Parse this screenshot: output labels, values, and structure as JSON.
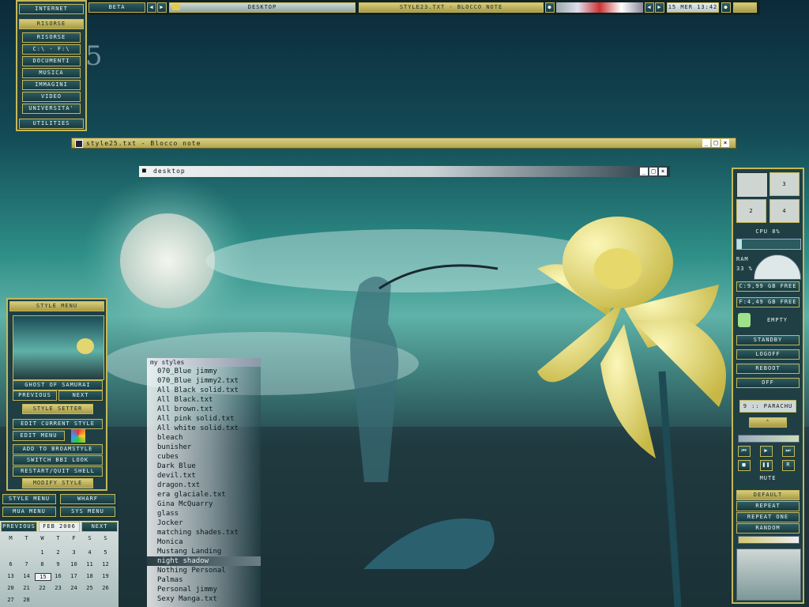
{
  "taskbar": {
    "workspace": "BETA",
    "window_title": "DESKTOP",
    "active_task": "STYLE23.TXT - BLOCCO NOTE",
    "clock": "15 MER 13:42"
  },
  "left_menu": {
    "items": [
      "INTERNET",
      "RISORSE",
      "RISORSE",
      "C:\\ - F:\\",
      "DOCUMENTI",
      "MUSICA",
      "IMMAGINI",
      "VIDEO",
      "UNIVERSITA'",
      "UTILITIES"
    ]
  },
  "windows": {
    "notepad_title": "style25.txt - Blocco note",
    "desktop_title": "desktop"
  },
  "style_menu": {
    "title": "STYLE MENU",
    "preview_caption": "GHOST OF SAMURAI",
    "previous": "PREVIOUS",
    "next": "NEXT",
    "setter": "STYLE SETTER",
    "edit_current": "EDIT CURRENT STYLE",
    "edit_menu": "EDIT MENU",
    "add_bro": "ADD TO BROAMSTYLE",
    "switch": "SWITCH BBI LOOK",
    "restart": "RESTART/QUIT SHELL",
    "modify": "MODIFY STYLE"
  },
  "dock": {
    "style_menu": "STYLE MENU",
    "wharf": "WHARF",
    "mua": "MUA MENU",
    "sys": "SYS MENU"
  },
  "calendar": {
    "previous": "PREVIOUS",
    "month": "FEB 2006",
    "next": "NEXT",
    "weekdays": [
      "M",
      "T",
      "W",
      "T",
      "F",
      "S",
      "S"
    ],
    "rows": [
      [
        "",
        "",
        "1",
        "2",
        "3",
        "4",
        "5"
      ],
      [
        "6",
        "7",
        "8",
        "9",
        "10",
        "11",
        "12"
      ],
      [
        "13",
        "14",
        "15",
        "16",
        "17",
        "18",
        "19"
      ],
      [
        "20",
        "21",
        "22",
        "23",
        "24",
        "25",
        "26"
      ],
      [
        "27",
        "28",
        "",
        "",
        "",
        "",
        ""
      ]
    ],
    "today": "15"
  },
  "styles_menu": {
    "header": "my styles",
    "items": [
      "070_Blue jimmy",
      "070_Blue jimmy2.txt",
      "All Black solid.txt",
      "All Black.txt",
      "All brown.txt",
      "All pink solid.txt",
      "All white solid.txt",
      "bleach",
      "bunisher",
      "cubes",
      "Dark Blue",
      "devil.txt",
      "dragon.txt",
      "era glaciale.txt",
      "Gina McQuarry",
      "glass",
      "Jocker",
      "matching shades.txt",
      "Monica",
      "Mustang Landing",
      "night shadow",
      "Nothing Personal",
      "Palmas",
      "Personal jimmy",
      "Sexy Manga.txt"
    ],
    "selected": "night shadow"
  },
  "right_panel": {
    "ws": [
      "3",
      "2",
      "4"
    ],
    "cpu": "CPU 8%",
    "cpu_level": 0.08,
    "ram": "RAM",
    "ram_pct": "33 %",
    "drive_c": "C:9,99 GB FREE",
    "drive_f": "F:4,49 GB FREE",
    "recycle": "EMPTY",
    "standby": "STANDBY",
    "logoff": "LOGOFF",
    "reboot": "REBOOT",
    "off": "OFF",
    "track": "9 :: PARACHU",
    "mute": "MUTE",
    "default": "DEFAULT",
    "repeat": "REPEAT",
    "repeat_one": "REPEAT ONE",
    "random": "RANDOM"
  }
}
